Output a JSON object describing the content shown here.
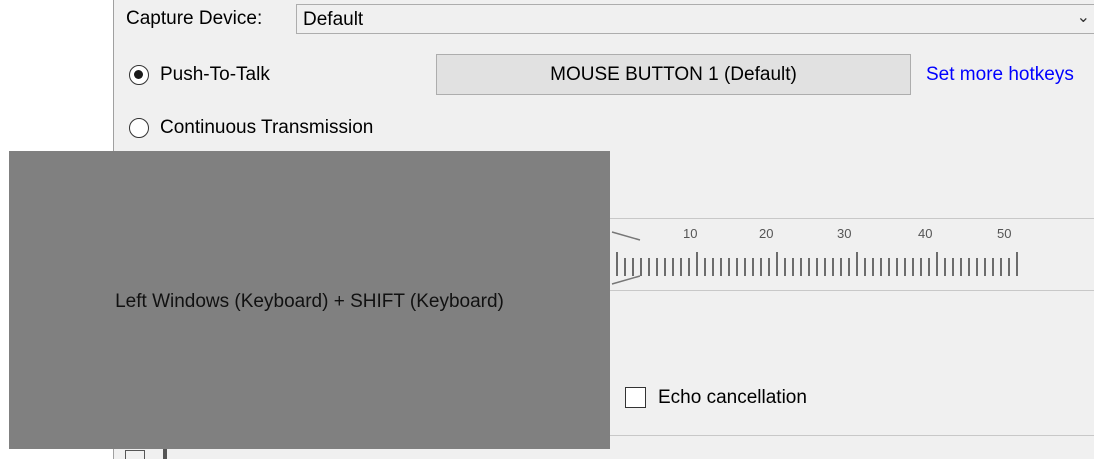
{
  "capture_device": {
    "label": "Capture Device:",
    "value": "Default"
  },
  "transmission": {
    "push_to_talk_label": "Push-To-Talk",
    "push_to_talk_selected": true,
    "continuous_label": "Continuous Transmission",
    "continuous_selected": false,
    "hotkey_button": "MOUSE BUTTON 1 (Default)",
    "more_hotkeys_link": "Set more hotkeys"
  },
  "slider": {
    "tick_labels": [
      "10",
      "20",
      "30",
      "40",
      "50"
    ]
  },
  "echo_cancellation": {
    "label": "Echo cancellation",
    "checked": false
  },
  "tooltip": {
    "text": "Left Windows (Keyboard) + SHIFT (Keyboard)"
  },
  "colors": {
    "link": "#0000ff",
    "tooltip_bg": "#808080",
    "panel_bg": "#f0f0f0"
  },
  "icons": {
    "combo_arrow": "chevron-down-icon"
  }
}
